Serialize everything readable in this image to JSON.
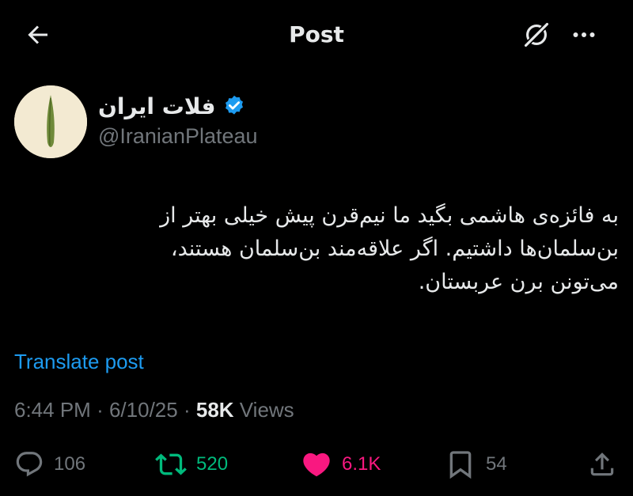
{
  "header": {
    "title": "Post",
    "back_icon": "arrow-left-icon",
    "grok_icon": "grok-icon",
    "more_icon": "more-horizontal-icon"
  },
  "author": {
    "display_name": "فلات ایران",
    "handle": "@IranianPlateau",
    "verified": true,
    "verified_color": "#1d9bf0"
  },
  "tweet": {
    "lines": [
      "به فائزه‌ی هاشمی بگید ما نیم‌قرن پیش خیلی بهتر از",
      "بن‌سلمان‌ها داشتیم. اگر علاقه‌مند بن‌سلمان هستند،",
      "می‌تونن برن عربستان."
    ],
    "translate_label": "Translate post"
  },
  "meta": {
    "time": "6:44 PM",
    "separator": "·",
    "date": "6/10/25",
    "views_count": "58K",
    "views_label": "Views"
  },
  "actions": {
    "reply_count": "106",
    "repost_count": "520",
    "like_count": "6.1K",
    "bookmark_count": "54",
    "liked": true,
    "reposted": true,
    "colors": {
      "muted": "#71767b",
      "repost": "#00ba7c",
      "like": "#f91880",
      "link": "#1d9bf0"
    }
  }
}
